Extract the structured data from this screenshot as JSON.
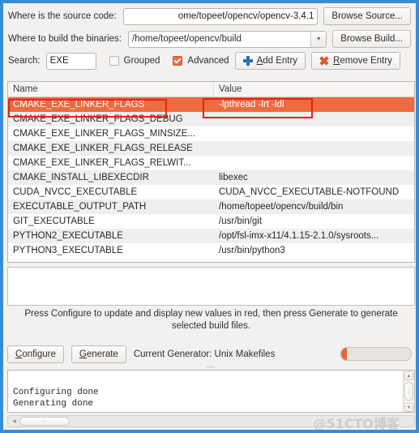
{
  "source_row": {
    "label": "Where is the source code:",
    "value": "ome/topeet/opencv/opencv-3.4.1",
    "browse_label": "Browse Source..."
  },
  "build_row": {
    "label": "Where to build the binaries:",
    "value": "/home/topeet/opencv/build",
    "browse_label": "Browse Build...",
    "arrow_icon": "chevron-down-icon"
  },
  "search_row": {
    "label": "Search:",
    "value": "EXE",
    "grouped_label": "Grouped",
    "grouped_checked": false,
    "advanced_label": "Advanced",
    "advanced_checked": true,
    "add_entry_label": "Add Entry",
    "add_entry_icon": "plus-icon",
    "remove_entry_label": "Remove Entry",
    "remove_entry_icon": "cross-icon"
  },
  "table": {
    "headers": [
      "Name",
      "Value"
    ],
    "selected_index": 0,
    "rows": [
      {
        "name": "CMAKE_EXE_LINKER_FLAGS",
        "value": "-lpthread -lrt -ldl"
      },
      {
        "name": "CMAKE_EXE_LINKER_FLAGS_DEBUG",
        "value": ""
      },
      {
        "name": "CMAKE_EXE_LINKER_FLAGS_MINSIZE...",
        "value": ""
      },
      {
        "name": "CMAKE_EXE_LINKER_FLAGS_RELEASE",
        "value": ""
      },
      {
        "name": "CMAKE_EXE_LINKER_FLAGS_RELWIT...",
        "value": ""
      },
      {
        "name": "CMAKE_INSTALL_LIBEXECDIR",
        "value": "libexec"
      },
      {
        "name": "CUDA_NVCC_EXECUTABLE",
        "value": "CUDA_NVCC_EXECUTABLE-NOTFOUND"
      },
      {
        "name": "EXECUTABLE_OUTPUT_PATH",
        "value": "/home/topeet/opencv/build/bin"
      },
      {
        "name": "GIT_EXECUTABLE",
        "value": "/usr/bin/git"
      },
      {
        "name": "PYTHON2_EXECUTABLE",
        "value": "/opt/fsl-imx-x11/4.1.15-2.1.0/sysroots..."
      },
      {
        "name": "PYTHON3_EXECUTABLE",
        "value": "/usr/bin/python3"
      }
    ]
  },
  "hint": "Press Configure to update and display new values in red, then press Generate to generate selected build files.",
  "actions": {
    "configure_label": "Configure",
    "generate_label": "Generate",
    "generator_label": "Current Generator: Unix Makefiles",
    "progress_percent": 8
  },
  "console": {
    "text": "\nConfiguring done\nGenerating done"
  },
  "watermark": "@51CTO博客",
  "colors": {
    "selection": "#ec6b3f",
    "annotation": "#e8201a",
    "window_border": "#3a8dd4",
    "checkbox_on": "#ec6b3f",
    "plus_icon": "#2f6fb5",
    "cross_icon": "#e2562a"
  }
}
